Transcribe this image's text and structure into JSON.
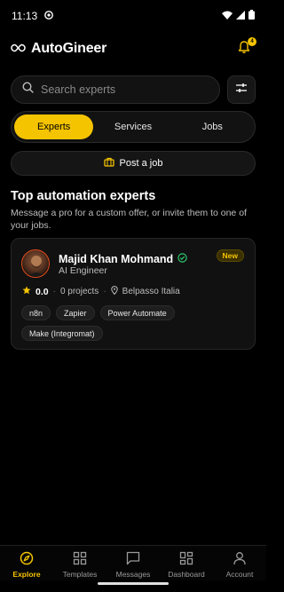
{
  "status_bar": {
    "time": "11:13"
  },
  "header": {
    "app_name": "AutoGineer",
    "notification_count": "4"
  },
  "search": {
    "placeholder": "Search experts"
  },
  "tabs": [
    {
      "label": "Experts",
      "active": true
    },
    {
      "label": "Services",
      "active": false
    },
    {
      "label": "Jobs",
      "active": false
    }
  ],
  "post_job": {
    "label": "Post a job"
  },
  "section": {
    "title": "Top automation experts",
    "subtitle": "Message a pro for a custom offer, or invite them to one of your jobs."
  },
  "expert": {
    "name": "Majid Khan Mohmand",
    "role": "AI Engineer",
    "badge": "New",
    "rating": "0.0",
    "projects": "0 projects",
    "location": "Belpasso Italia",
    "skills": [
      "n8n",
      "Zapier",
      "Power Automate",
      "Make (Integromat)"
    ]
  },
  "bottom_nav": [
    {
      "label": "Explore",
      "icon": "compass-icon",
      "active": true
    },
    {
      "label": "Templates",
      "icon": "grid-icon",
      "active": false
    },
    {
      "label": "Messages",
      "icon": "chat-icon",
      "active": false
    },
    {
      "label": "Dashboard",
      "icon": "dashboard-icon",
      "active": false
    },
    {
      "label": "Account",
      "icon": "person-icon",
      "active": false
    }
  ],
  "colors": {
    "accent": "#f5c400",
    "background": "#000000",
    "verified": "#2ecc71"
  }
}
